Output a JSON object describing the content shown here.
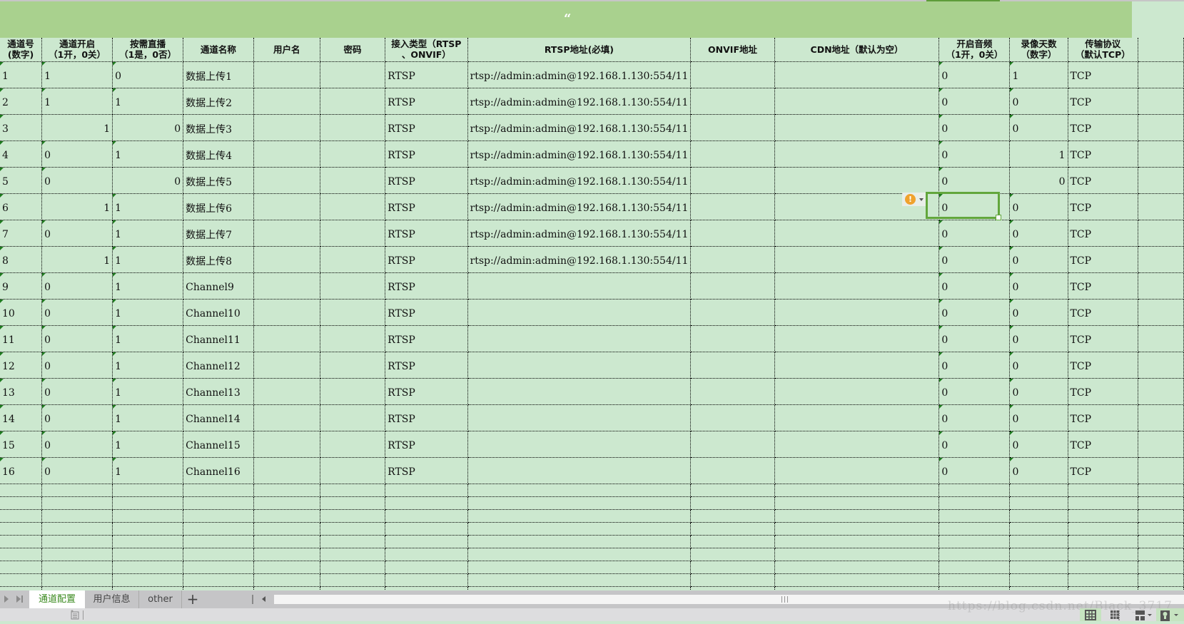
{
  "sheet": {
    "title_mark": "“",
    "headers": [
      [
        "通道号",
        "(数字)"
      ],
      [
        "通道开启",
        "（1开，0关）"
      ],
      [
        "按需直播",
        "（1是，0否）"
      ],
      [
        "通道名称"
      ],
      [
        "用户名"
      ],
      [
        "密码"
      ],
      [
        "接入类型（RTSP",
        "、ONVIF）"
      ],
      [
        "RTSP地址(必填)"
      ],
      [
        "ONVIF地址"
      ],
      [
        "CDN地址（默认为空）"
      ],
      [
        "开启音频",
        "（1开，0关）"
      ],
      [
        "录像天数",
        "（数字）"
      ],
      [
        "传输协议",
        "（默认TCP）"
      ],
      [
        ""
      ]
    ],
    "rows": [
      {
        "id": "1",
        "open": "1",
        "ondemand": "0",
        "name": "数据上传1",
        "user": "",
        "pwd": "",
        "type": "RTSP",
        "rtsp": "rtsp://admin:admin@192.168.1.130:554/11",
        "onvif": "",
        "cdn": "",
        "audio": "0",
        "days": "1",
        "proto": "TCP",
        "align": {
          "open": "l",
          "ondemand": "l",
          "days": "l"
        }
      },
      {
        "id": "2",
        "open": "1",
        "ondemand": "1",
        "name": "数据上传2",
        "user": "",
        "pwd": "",
        "type": "RTSP",
        "rtsp": "rtsp://admin:admin@192.168.1.130:554/11",
        "onvif": "",
        "cdn": "",
        "audio": "0",
        "days": "0",
        "proto": "TCP",
        "align": {
          "open": "l",
          "ondemand": "l",
          "days": "l"
        }
      },
      {
        "id": "3",
        "open": "1",
        "ondemand": "0",
        "name": "数据上传3",
        "user": "",
        "pwd": "",
        "type": "RTSP",
        "rtsp": "rtsp://admin:admin@192.168.1.130:554/11",
        "onvif": "",
        "cdn": "",
        "audio": "0",
        "days": "0",
        "proto": "TCP",
        "align": {
          "open": "r",
          "ondemand": "r",
          "days": "l"
        }
      },
      {
        "id": "4",
        "open": "0",
        "ondemand": "1",
        "name": "数据上传4",
        "user": "",
        "pwd": "",
        "type": "RTSP",
        "rtsp": "rtsp://admin:admin@192.168.1.130:554/11",
        "onvif": "",
        "cdn": "",
        "audio": "0",
        "days": "1",
        "proto": "TCP",
        "align": {
          "open": "l",
          "ondemand": "l",
          "days": "r"
        }
      },
      {
        "id": "5",
        "open": "0",
        "ondemand": "0",
        "name": "数据上传5",
        "user": "",
        "pwd": "",
        "type": "RTSP",
        "rtsp": "rtsp://admin:admin@192.168.1.130:554/11",
        "onvif": "",
        "cdn": "",
        "audio": "0",
        "days": "0",
        "proto": "TCP",
        "align": {
          "open": "l",
          "ondemand": "r",
          "days": "r"
        }
      },
      {
        "id": "6",
        "open": "1",
        "ondemand": "1",
        "name": "数据上传6",
        "user": "",
        "pwd": "",
        "type": "RTSP",
        "rtsp": "rtsp://admin:admin@192.168.1.130:554/11",
        "onvif": "",
        "cdn": "",
        "audio": "0",
        "days": "0",
        "proto": "TCP",
        "align": {
          "open": "r",
          "ondemand": "l",
          "days": "l"
        }
      },
      {
        "id": "7",
        "open": "0",
        "ondemand": "1",
        "name": "数据上传7",
        "user": "",
        "pwd": "",
        "type": "RTSP",
        "rtsp": "rtsp://admin:admin@192.168.1.130:554/11",
        "onvif": "",
        "cdn": "",
        "audio": "0",
        "days": "0",
        "proto": "TCP",
        "align": {
          "open": "l",
          "ondemand": "l",
          "days": "l"
        }
      },
      {
        "id": "8",
        "open": "1",
        "ondemand": "1",
        "name": "数据上传8",
        "user": "",
        "pwd": "",
        "type": "RTSP",
        "rtsp": "rtsp://admin:admin@192.168.1.130:554/11",
        "onvif": "",
        "cdn": "",
        "audio": "0",
        "days": "0",
        "proto": "TCP",
        "align": {
          "open": "r",
          "ondemand": "l",
          "days": "l"
        }
      },
      {
        "id": "9",
        "open": "0",
        "ondemand": "1",
        "name": "Channel9",
        "user": "",
        "pwd": "",
        "type": "RTSP",
        "rtsp": "",
        "onvif": "",
        "cdn": "",
        "audio": "0",
        "days": "0",
        "proto": "TCP",
        "align": {
          "open": "l",
          "ondemand": "l",
          "days": "l"
        }
      },
      {
        "id": "10",
        "open": "0",
        "ondemand": "1",
        "name": "Channel10",
        "user": "",
        "pwd": "",
        "type": "RTSP",
        "rtsp": "",
        "onvif": "",
        "cdn": "",
        "audio": "0",
        "days": "0",
        "proto": "TCP",
        "align": {
          "open": "l",
          "ondemand": "l",
          "days": "l"
        }
      },
      {
        "id": "11",
        "open": "0",
        "ondemand": "1",
        "name": "Channel11",
        "user": "",
        "pwd": "",
        "type": "RTSP",
        "rtsp": "",
        "onvif": "",
        "cdn": "",
        "audio": "0",
        "days": "0",
        "proto": "TCP",
        "align": {
          "open": "l",
          "ondemand": "l",
          "days": "l"
        }
      },
      {
        "id": "12",
        "open": "0",
        "ondemand": "1",
        "name": "Channel12",
        "user": "",
        "pwd": "",
        "type": "RTSP",
        "rtsp": "",
        "onvif": "",
        "cdn": "",
        "audio": "0",
        "days": "0",
        "proto": "TCP",
        "align": {
          "open": "l",
          "ondemand": "l",
          "days": "l"
        }
      },
      {
        "id": "13",
        "open": "0",
        "ondemand": "1",
        "name": "Channel13",
        "user": "",
        "pwd": "",
        "type": "RTSP",
        "rtsp": "",
        "onvif": "",
        "cdn": "",
        "audio": "0",
        "days": "0",
        "proto": "TCP",
        "align": {
          "open": "l",
          "ondemand": "l",
          "days": "l"
        }
      },
      {
        "id": "14",
        "open": "0",
        "ondemand": "1",
        "name": "Channel14",
        "user": "",
        "pwd": "",
        "type": "RTSP",
        "rtsp": "",
        "onvif": "",
        "cdn": "",
        "audio": "0",
        "days": "0",
        "proto": "TCP",
        "align": {
          "open": "l",
          "ondemand": "l",
          "days": "l"
        }
      },
      {
        "id": "15",
        "open": "0",
        "ondemand": "1",
        "name": "Channel15",
        "user": "",
        "pwd": "",
        "type": "RTSP",
        "rtsp": "",
        "onvif": "",
        "cdn": "",
        "audio": "0",
        "days": "0",
        "proto": "TCP",
        "align": {
          "open": "l",
          "ondemand": "l",
          "days": "l"
        }
      },
      {
        "id": "16",
        "open": "0",
        "ondemand": "1",
        "name": "Channel16",
        "user": "",
        "pwd": "",
        "type": "RTSP",
        "rtsp": "",
        "onvif": "",
        "cdn": "",
        "audio": "0",
        "days": "0",
        "proto": "TCP",
        "align": {
          "open": "l",
          "ondemand": "l",
          "days": "l"
        }
      }
    ],
    "empty_row_count": 9,
    "selected_cell": {
      "row": "6",
      "column": "开启音频",
      "value": "0"
    },
    "error_indicator": {
      "icon": "warning-icon",
      "symbol": "!"
    }
  },
  "tabs": {
    "items": [
      {
        "label": "通道配置",
        "active": true
      },
      {
        "label": "用户信息",
        "active": false
      },
      {
        "label": "other",
        "active": false
      }
    ],
    "add_label": "+",
    "scroll_grip": "|||"
  },
  "statusbar": {
    "watermark": "https://blog.csdn.net/Black_3717",
    "views": [
      "normal-view-icon",
      "page-break-view-icon",
      "page-layout-icon",
      "reading-mode-icon"
    ]
  },
  "colors": {
    "cell_bg": "#cce8cf",
    "header_band": "#a9d18e",
    "selection": "#62a63c",
    "active_tab_text": "#3a8a1e",
    "warning": "#f0a22e"
  }
}
